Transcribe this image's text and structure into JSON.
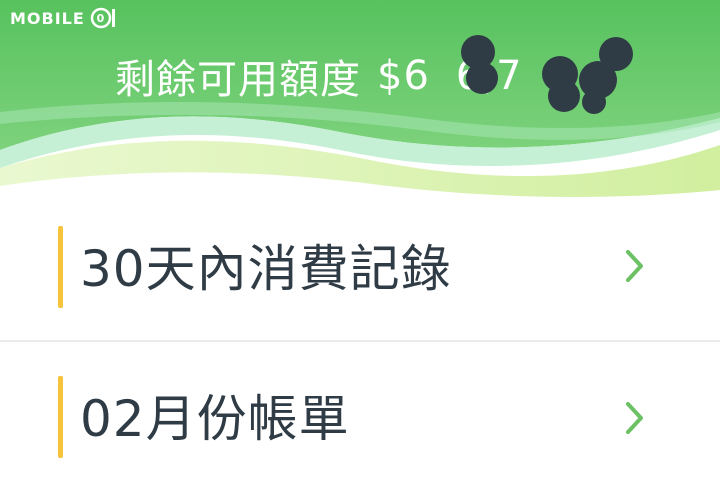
{
  "watermark": {
    "text": "MOBILE",
    "logo_icon": "mobile01-logo-icon"
  },
  "header": {
    "label": "剩餘可用額度",
    "amount_visible": "$6",
    "amount_visible_2": "6,7",
    "redaction_icon": "redaction-blobs-icon",
    "colors": {
      "top": "#5cc662",
      "wave_light": "#b7ecc2",
      "wave_lime": "#d8f2a3"
    }
  },
  "menu": {
    "items": [
      {
        "label": "30天內消費記錄",
        "accent_color": "#f6c33a",
        "chevron_icon": "chevron-right-icon"
      },
      {
        "label": "02月份帳單",
        "accent_color": "#f6c33a",
        "chevron_icon": "chevron-right-icon"
      }
    ],
    "chevron_color": "#6cc164"
  }
}
